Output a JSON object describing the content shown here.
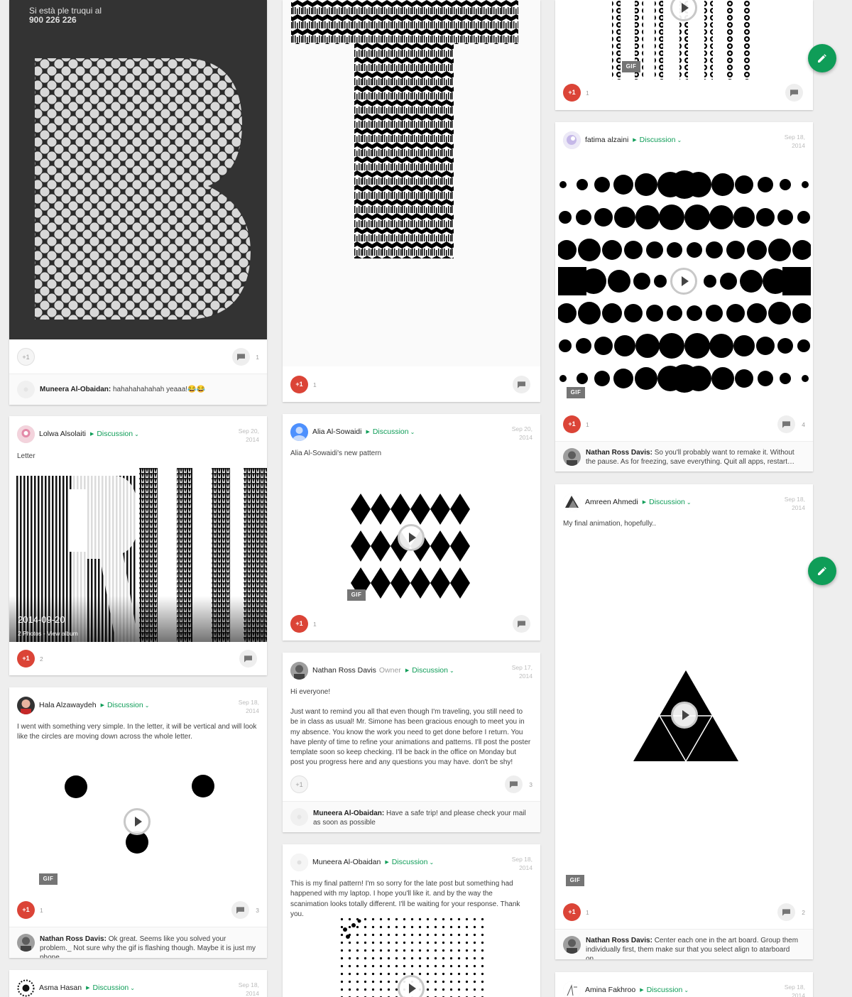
{
  "common": {
    "category": "Discussion",
    "plus_label": "+1",
    "gif_label": "GIF"
  },
  "col1": {
    "b_poster": {
      "poster_line1": "Si està ple truqui al",
      "poster_line2": "900 226 226",
      "plus_count": "",
      "comment_count": "1",
      "comment_author": "Muneera Al-Obaidan:",
      "comment_text": "hahahahahahah yeaaa!😂😂"
    },
    "lolwa": {
      "author": "Lolwa Alsolaiti",
      "date_line1": "Sep 20,",
      "date_line2": "2014",
      "text": "Letter",
      "album_date": "2014-09-20",
      "album_meta": "2 Photos - View album",
      "plus_count": "2",
      "comment_count": ""
    },
    "hala": {
      "author": "Hala Alzawaydeh",
      "date_line1": "Sep 18,",
      "date_line2": "2014",
      "text": "I went with something very simple. In the letter, it will be vertical and will look like the circles are moving down across the whole letter.",
      "plus_count": "1",
      "comment_count": "3",
      "comment_author": "Nathan Ross Davis:",
      "comment_text": "Ok great. Seems like you solved your problem._ Not sure why the gif is flashing though. Maybe it is just my phone."
    },
    "asma": {
      "author": "Asma Hasan",
      "date_line1": "Sep 18,",
      "date_line2": "2014"
    }
  },
  "col2": {
    "t_card": {
      "plus_count": "1",
      "comment_count": ""
    },
    "alia": {
      "author": "Alia Al-Sowaidi",
      "date_line1": "Sep 20,",
      "date_line2": "2014",
      "text": "Alia Al-Sowaidi's new pattern",
      "plus_count": "1",
      "comment_count": ""
    },
    "nathan": {
      "author": "Nathan Ross Davis",
      "role": "Owner",
      "date_line1": "Sep 17,",
      "date_line2": "2014",
      "greeting": "Hi everyone!",
      "text": "Just want to remind you all that even though I'm traveling, you still need to be in class as usual! Mr. Simone has been gracious enough to meet you in my absence. You know the work you need to get done before I return. You have plenty of time to refine your animations and patterns. I'll post the poster template soon so keep checking. I'll be back in the office on Monday but post you progress here and any questions you may have. don't be shy!",
      "plus_count": "",
      "comment_count": "3",
      "comment_author": "Muneera Al-Obaidan:",
      "comment_text": "Have a safe trip! and please check your mail as soon as possible"
    },
    "muneera": {
      "author": "Muneera Al-Obaidan",
      "date_line1": "Sep 18,",
      "date_line2": "2014",
      "text": "This is my final pattern! I'm so sorry for the late post but something had happened with my laptop. I hope you'll like it. and by the way the scanimation looks totally different. I'll be waiting for your response. Thank you."
    }
  },
  "col3": {
    "top_card": {
      "plus_count": "1",
      "comment_count": ""
    },
    "fatima": {
      "author": "fatima alzaini",
      "date_line1": "Sep 18,",
      "date_line2": "2014",
      "plus_count": "1",
      "comment_count": "4",
      "comment_author": "Nathan Ross Davis:",
      "comment_text": "So you'll probably want to remake it. Without the pause. As for freezing, save everything. Quit all apps, restart…"
    },
    "amreen": {
      "author": "Amreen Ahmedi",
      "date_line1": "Sep 18,",
      "date_line2": "2014",
      "text": "My final animation, hopefully..",
      "plus_count": "1",
      "comment_count": "2",
      "comment_author": "Nathan Ross Davis:",
      "comment_text": "Center each one in the art board. Group them individually first, them make sur that you select align to atarboard on…"
    },
    "amina": {
      "author": "Amina Fakhroo",
      "date_line1": "Sep 18,",
      "date_line2": "2014"
    }
  },
  "colors": {
    "accent_green": "#0f9d58",
    "plus_red": "#db4437",
    "background": "#eeeeee"
  },
  "icons": [
    "comment-icon",
    "edit-pencil-icon",
    "play-icon",
    "chevron-down-icon",
    "breadcrumb-arrow-icon"
  ]
}
